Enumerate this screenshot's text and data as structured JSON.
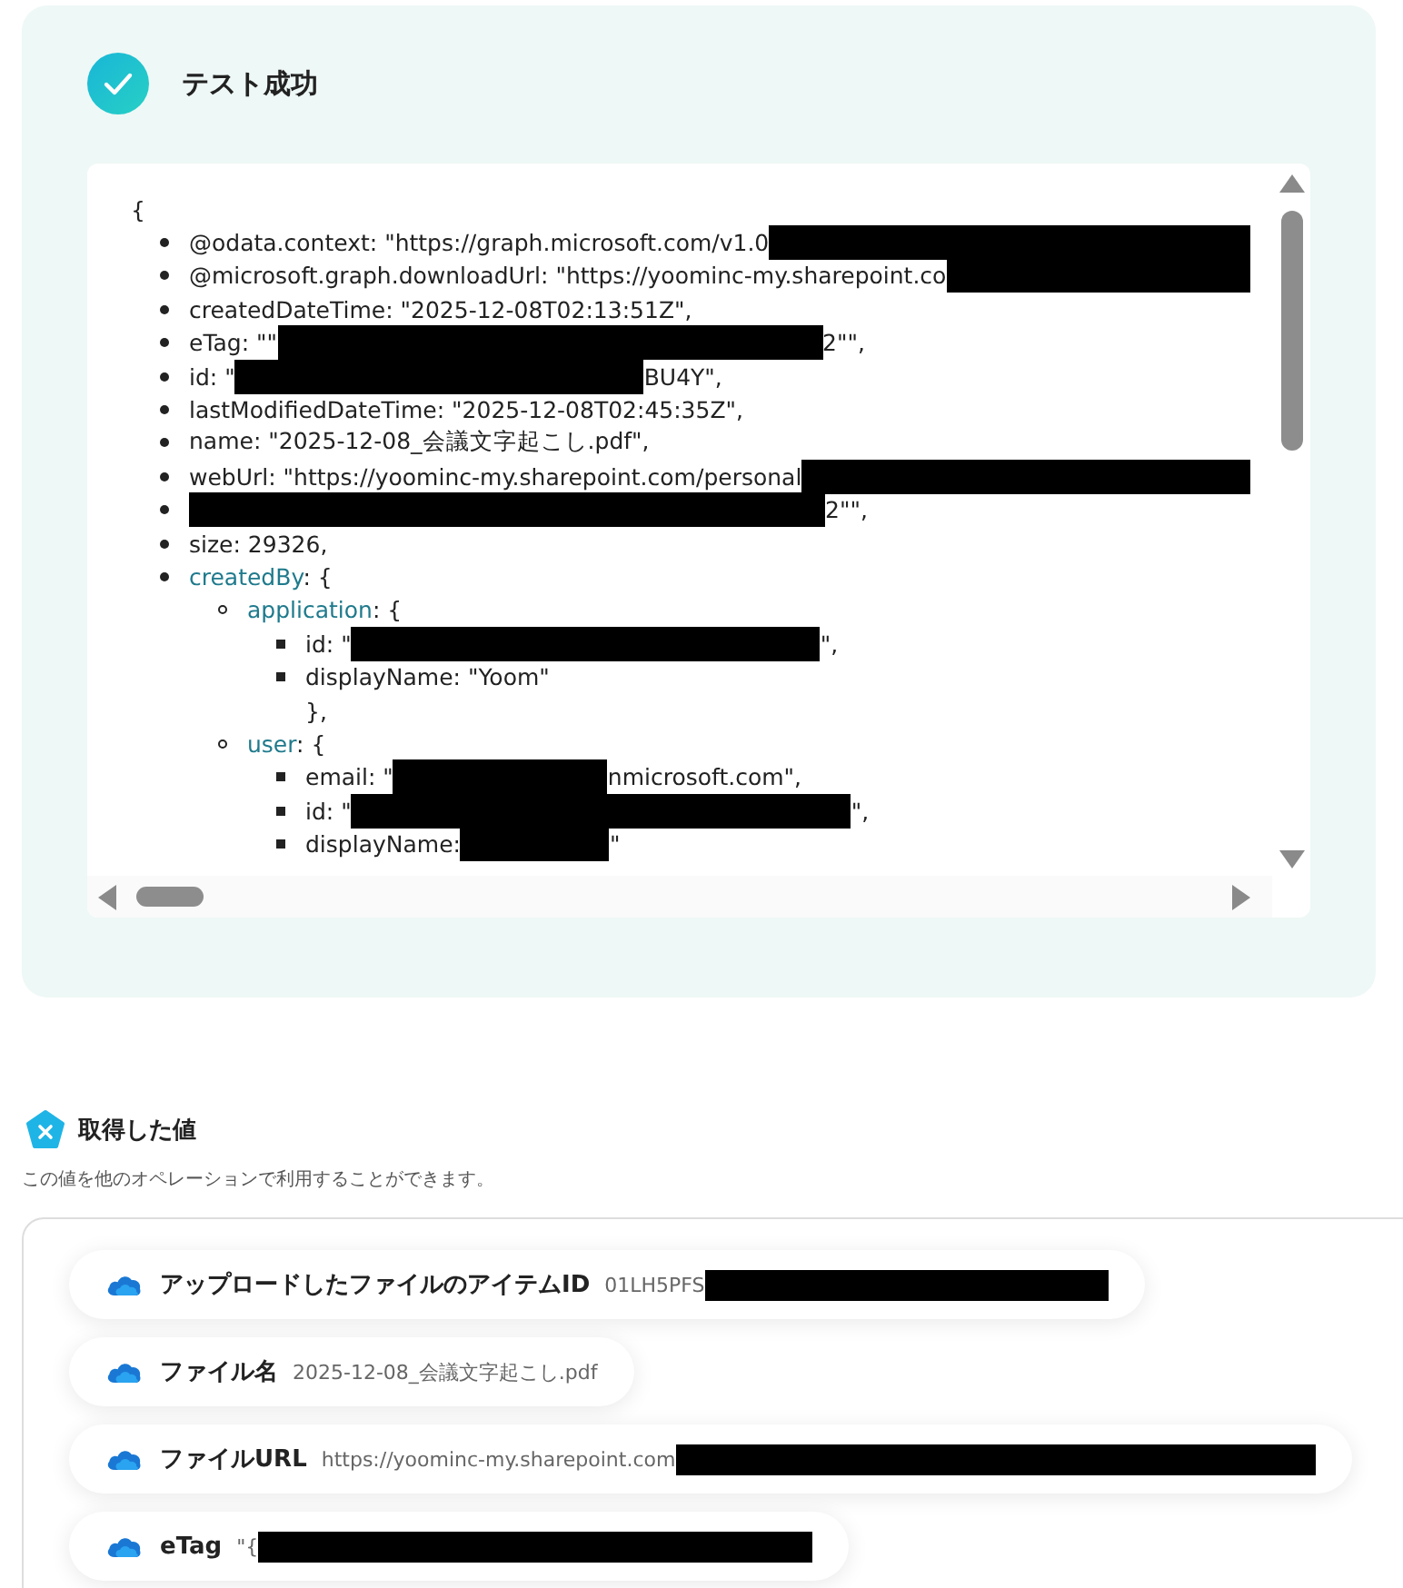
{
  "result": {
    "title": "テスト成功",
    "open_brace": "{",
    "tree": [
      {
        "key": "@odata.context",
        "text": ": \"https://graph.microsoft.com/v1.0",
        "redacted": true
      },
      {
        "key": "@microsoft.graph.downloadUrl",
        "text": ": \"https://yoominc-my.sharepoint.co",
        "redacted": true
      },
      {
        "key": "createdDateTime",
        "text": ": \"2025-12-08T02:13:51Z\","
      },
      {
        "key": "eTag",
        "text": ": \"\"",
        "redacted": true,
        "after": "2\"\","
      },
      {
        "key": "id",
        "text": ": \"",
        "redacted": true,
        "after": "BU4Y\","
      },
      {
        "key": "lastModifiedDateTime",
        "text": ": \"2025-12-08T02:45:35Z\","
      },
      {
        "key": "name",
        "text": ": \"2025-12-08_会議文字起こし.pdf\","
      },
      {
        "key": "webUrl",
        "text": ": \"https://yoominc-my.sharepoint.com/personal",
        "redacted": true
      },
      {
        "redacted": true,
        "after": "2\"\","
      },
      {
        "key": "size",
        "text": ": 29326,"
      },
      {
        "key": "createdBy",
        "text": ": {",
        "kind": "object",
        "children": [
          {
            "key": "application",
            "text": ": {",
            "kind": "object",
            "close": "},",
            "children": [
              {
                "key": "id",
                "text": ": \"",
                "redacted": true,
                "after": "\","
              },
              {
                "key": "displayName",
                "text": ": \"Yoom\""
              }
            ]
          },
          {
            "key": "user",
            "text": ": {",
            "kind": "object",
            "children": [
              {
                "key": "email",
                "text": ": \"",
                "redacted": true,
                "after": "nmicrosoft.com\","
              },
              {
                "key": "id",
                "text": ": \"",
                "redacted": true,
                "after": "\","
              },
              {
                "key": "displayName",
                "text": ":",
                "redacted": true,
                "after": "\""
              }
            ]
          }
        ]
      }
    ]
  },
  "values": {
    "title": "取得した値",
    "description": "この値を他のオペレーションで利用することができます。",
    "items": [
      {
        "label": "アップロードしたファイルのアイテムID",
        "value": "01LH5PFS",
        "redacted": true
      },
      {
        "label": "ファイル名",
        "value": "2025-12-08_会議文字起こし.pdf"
      },
      {
        "label": "ファイルURL",
        "value": "https://yoominc-my.sharepoint.com",
        "redacted": true
      },
      {
        "label": "eTag",
        "value": "\"{",
        "redacted": true
      }
    ]
  }
}
